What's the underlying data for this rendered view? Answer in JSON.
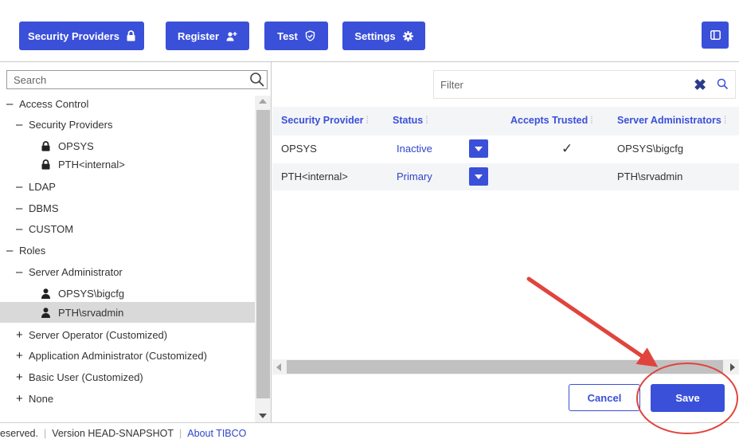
{
  "toolbar": {
    "security_providers_label": "Security Providers",
    "register_label": "Register",
    "test_label": "Test",
    "settings_label": "Settings"
  },
  "tree": {
    "search_placeholder": "Search",
    "nodes": [
      {
        "label": "Access Control",
        "toggle": "–"
      },
      {
        "label": "Security Providers",
        "toggle": "–"
      },
      {
        "label": "OPSYS",
        "icon": "lock-icon"
      },
      {
        "label": "PTH<internal>",
        "icon": "lock-icon"
      },
      {
        "label": "LDAP",
        "toggle": "–"
      },
      {
        "label": "DBMS",
        "toggle": "–"
      },
      {
        "label": "CUSTOM",
        "toggle": "–"
      },
      {
        "label": "Roles",
        "toggle": "–"
      },
      {
        "label": "Server Administrator",
        "toggle": "–"
      },
      {
        "label": "OPSYS\\bigcfg",
        "icon": "user-icon"
      },
      {
        "label": "PTH\\srvadmin",
        "icon": "user-icon",
        "selected": true
      },
      {
        "label": "Server Operator (Customized)",
        "toggle": "+"
      },
      {
        "label": "Application Administrator (Customized)",
        "toggle": "+"
      },
      {
        "label": "Basic User (Customized)",
        "toggle": "+"
      },
      {
        "label": "None",
        "toggle": "+"
      }
    ]
  },
  "table": {
    "filter_placeholder": "Filter",
    "columns": [
      "Security Provider",
      "Status",
      "Accepts Trusted",
      "Server Administrators"
    ],
    "rows": [
      {
        "provider": "OPSYS",
        "status": "Inactive",
        "accepts_trusted": "✓",
        "admins": "OPSYS\\bigcfg"
      },
      {
        "provider": "PTH<internal>",
        "status": "Primary",
        "accepts_trusted": "",
        "admins": "PTH\\srvadmin"
      }
    ]
  },
  "actions": {
    "cancel_label": "Cancel",
    "save_label": "Save"
  },
  "footer": {
    "rights": "eserved.",
    "version": "Version HEAD-SNAPSHOT",
    "about": "About TIBCO"
  },
  "colors": {
    "accent": "#3a50d9",
    "annotation": "#e0443c"
  }
}
